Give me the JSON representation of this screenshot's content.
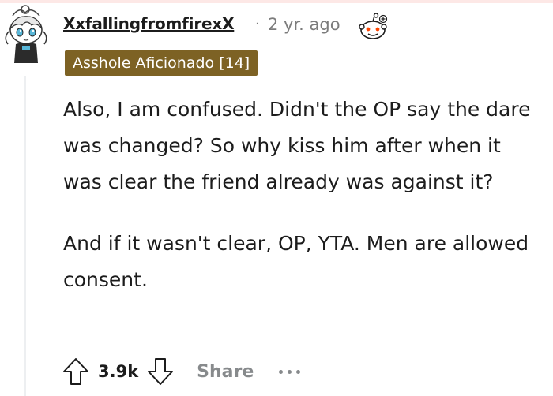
{
  "comment": {
    "username": "XxfallingfromfirexX",
    "separator": "·",
    "timestamp": "2 yr. ago",
    "flair": "Asshole Aficionado [14]",
    "paragraphs": [
      "Also, I am confused. Didn't the OP say the dare was changed? So why kiss him after when it was clear the friend already was against it?",
      "And if it wasn't clear, OP, YTA. Men are allowed consent."
    ]
  },
  "actions": {
    "score": "3.9k",
    "share_label": "Share",
    "upvote_icon": "arrow-up-icon",
    "downvote_icon": "arrow-down-icon",
    "more_icon": "more-options-icon"
  },
  "colors": {
    "flair_bg": "#7d6224",
    "muted_text": "#7c7c7c",
    "action_gray": "#878a8c"
  }
}
